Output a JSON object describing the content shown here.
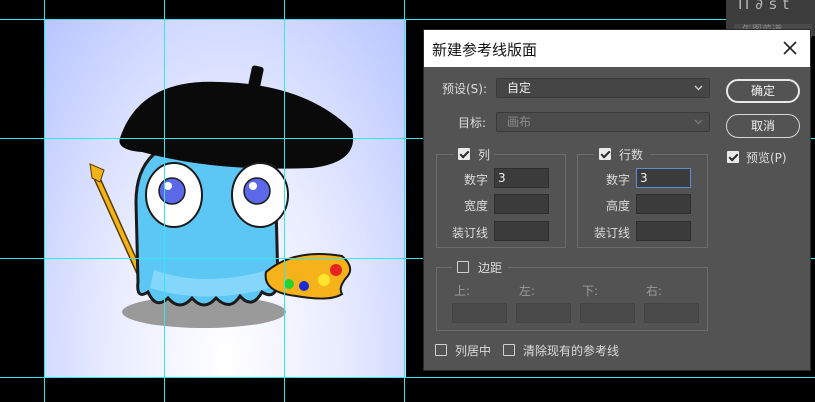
{
  "top_panel": {
    "icons": [
      "paragraph-icon",
      "link-icon",
      "text-style-icon"
    ],
    "icon_glyphs": [
      "Π",
      "∂",
      "st"
    ],
    "label": "矢图菜道"
  },
  "dialog": {
    "title": "新建参考线版面",
    "preset_label": "预设(S):",
    "preset_value": "自定",
    "target_label": "目标:",
    "target_value": "画布",
    "columns": {
      "label": "列",
      "checked": true,
      "number_label": "数字",
      "number_value": "3",
      "width_label": "宽度",
      "width_value": "",
      "gutter_label": "装订线",
      "gutter_value": ""
    },
    "rows": {
      "label": "行数",
      "checked": true,
      "number_label": "数字",
      "number_value": "3",
      "height_label": "高度",
      "height_value": "",
      "gutter_label": "装订线",
      "gutter_value": ""
    },
    "margin": {
      "label": "边距",
      "checked": false,
      "top_label": "上:",
      "left_label": "左:",
      "bottom_label": "下:",
      "right_label": "右:"
    },
    "center_columns_label": "列居中",
    "center_columns_checked": false,
    "clear_existing_label": "清除现有的参考线",
    "clear_existing_checked": false,
    "ok_label": "确定",
    "cancel_label": "取消",
    "preview_label": "预览(P)",
    "preview_checked": true
  },
  "colors": {
    "guide": "#33e7f0",
    "dialog_bg": "#535353",
    "canvas_bg": "#000000"
  }
}
